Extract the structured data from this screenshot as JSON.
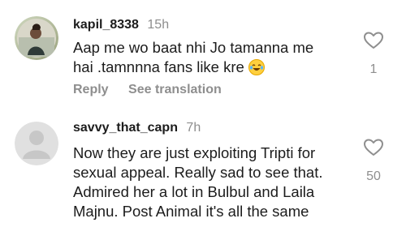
{
  "comments": [
    {
      "username": "kapil_8338",
      "time": "15h",
      "text_line1": "Aap me wo baat nhi Jo tamanna me",
      "text_line2": "hai .tamnnna fans like kre",
      "likes": "1",
      "reply_label": "Reply",
      "translate_label": "See translation"
    },
    {
      "username": "savvy_that_capn",
      "time": "7h",
      "text_lines": [
        "Now they are just exploiting Tripti for",
        "sexual appeal. Really sad to see that.",
        "Admired her a lot in Bulbul and Laila",
        "Majnu. Post Animal it's all the same"
      ],
      "likes": "50"
    }
  ]
}
